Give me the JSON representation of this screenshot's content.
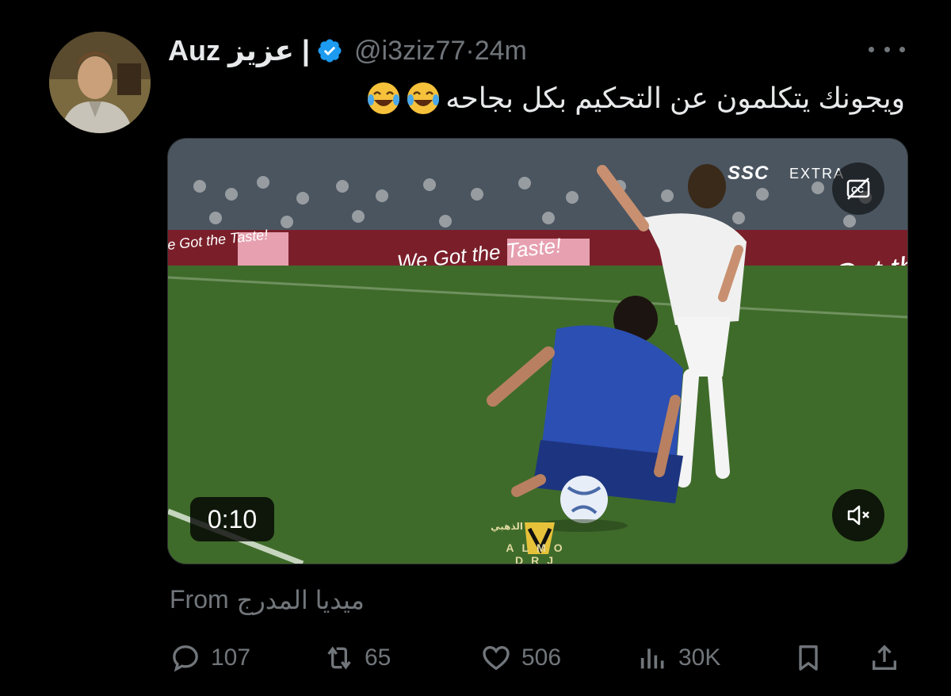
{
  "author": {
    "display_name_latin": "Auz",
    "display_name_arabic": "| عزيز",
    "handle": "@i3ziz77",
    "separator": "·",
    "time_ago": "24m",
    "verified": true
  },
  "tweet": {
    "text": "ويجونك يتكلمون عن التحكيم بكل بجاحه",
    "emojis": [
      "face-with-tears-of-joy",
      "face-with-tears-of-joy"
    ]
  },
  "media": {
    "duration": "0:10",
    "broadcaster": "SSC",
    "channel": "EXTRA",
    "banner_text": "We Got the Taste!",
    "watermark_text": "ALMO DRJ",
    "watermark_arabic": "الذهبي"
  },
  "source": {
    "label": "From",
    "name": "ميديا المدرج"
  },
  "actions": {
    "replies": "107",
    "reposts": "65",
    "likes": "506",
    "views": "30K"
  },
  "colors": {
    "background": "#000000",
    "text": "#e7e9ea",
    "muted": "#71767b",
    "verified": "#1d9bf0",
    "pitch": "#3f6b2a"
  }
}
